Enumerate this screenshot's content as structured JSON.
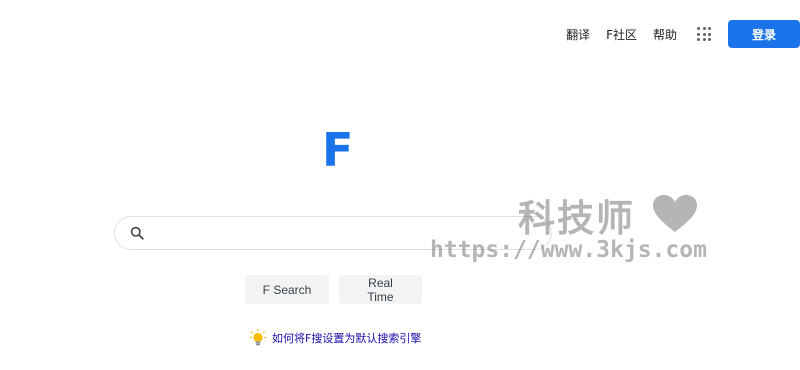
{
  "header": {
    "nav": [
      {
        "label": "翻译"
      },
      {
        "label": "F社区"
      },
      {
        "label": "帮助"
      }
    ],
    "apps_icon": "apps-grid-icon",
    "login_label": "登录"
  },
  "logo": {
    "text": "F",
    "color": "#1a73e8"
  },
  "search": {
    "value": "",
    "placeholder": "",
    "icon": "search-icon"
  },
  "buttons": {
    "f_search": "F Search",
    "real_time": "Real Time"
  },
  "tip": {
    "icon": "lightbulb-icon",
    "text": "如何将F搜设置为默认搜索引擎"
  },
  "watermark": {
    "title": "科技师",
    "url": "https://www.3kjs.com",
    "icon": "heart-icon"
  },
  "colors": {
    "accent": "#1a73e8",
    "link": "#1a0dab",
    "button_bg": "#f1f3f4"
  }
}
